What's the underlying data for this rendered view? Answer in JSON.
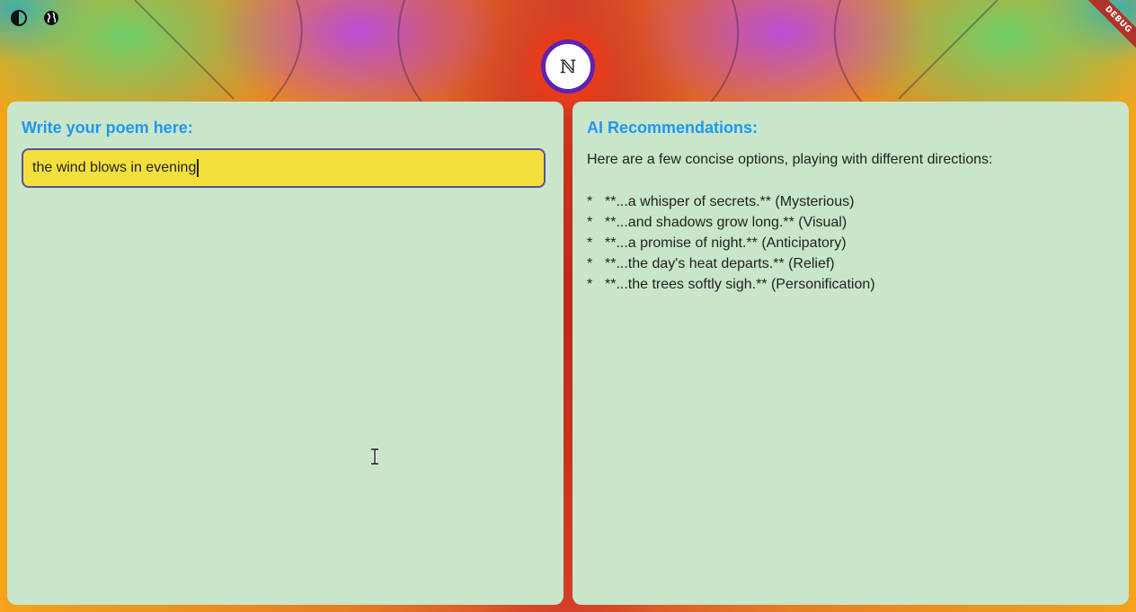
{
  "app": {
    "logo_text": "ℕ",
    "debug_banner": "DEBUG",
    "accent_heading_color": "#2196f3",
    "panel_background": "#c8e6c9",
    "input_background": "#f4e03d",
    "logo_ring_color": "#5b24b3"
  },
  "toolbar": {
    "icons": [
      "contrast-icon",
      "globe-icon"
    ]
  },
  "editor": {
    "heading": "Write your poem here:",
    "input_value": "the wind blows in evening"
  },
  "recommendations": {
    "heading": "AI Recommendations:",
    "intro": "Here are a few concise options, playing with different directions:",
    "items": [
      {
        "bullet": "*",
        "text": "**...a whisper of secrets.** (Mysterious)"
      },
      {
        "bullet": "*",
        "text": "**...and shadows grow long.** (Visual)"
      },
      {
        "bullet": "*",
        "text": "**...a promise of night.** (Anticipatory)"
      },
      {
        "bullet": "*",
        "text": "**...the day's heat departs.** (Relief)"
      },
      {
        "bullet": "*",
        "text": "**...the trees softly sigh.** (Personification)"
      }
    ]
  }
}
